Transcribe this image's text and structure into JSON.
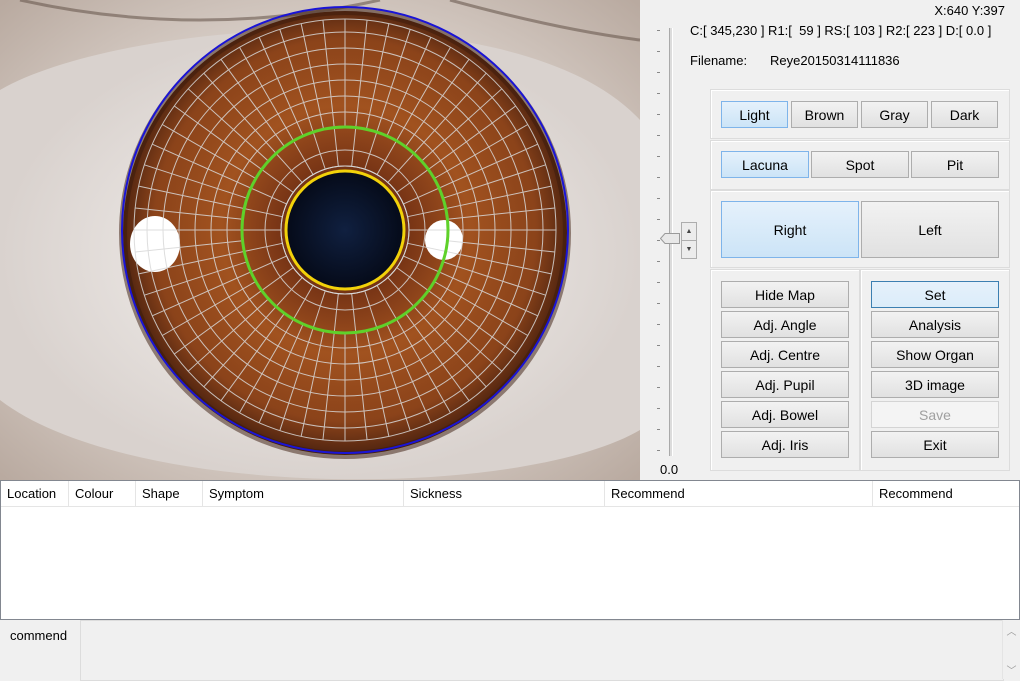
{
  "readout": {
    "coords": "X:640 Y:397",
    "params": "C:[ 345,230 ] R1:[  59 ] RS:[ 103 ] R2:[ 223 ] D:[ 0.0 ]",
    "filename_label": "Filename:",
    "filename_value": "Reye20150314111836"
  },
  "slider": {
    "value_label": "0.0",
    "position": 0.49
  },
  "colour_buttons": {
    "light": "Light",
    "brown": "Brown",
    "gray": "Gray",
    "dark": "Dark",
    "selected": "Light"
  },
  "mark_buttons": {
    "lacuna": "Lacuna",
    "spot": "Spot",
    "pit": "Pit",
    "selected": "Lacuna"
  },
  "side_buttons": {
    "right": "Right",
    "left": "Left",
    "selected": "Right"
  },
  "adjust_buttons": {
    "hide_map": "Hide Map",
    "adj_angle": "Adj. Angle",
    "adj_centre": "Adj. Centre",
    "adj_pupil": "Adj. Pupil",
    "adj_bowel": "Adj. Bowel",
    "adj_iris": "Adj. Iris"
  },
  "action_buttons": {
    "set": "Set",
    "analysis": "Analysis",
    "show_organ": "Show Organ",
    "image_3d": "3D image",
    "save": "Save",
    "exit": "Exit"
  },
  "table": {
    "columns": [
      "Location",
      "Colour",
      "Shape",
      "Symptom",
      "Sickness",
      "Recommend",
      "Recommend"
    ],
    "rows": []
  },
  "comment": {
    "label": "commend",
    "value": ""
  },
  "colors": {
    "outer_circle": "#1a14d6",
    "iris_boundary": "#5fd12a",
    "pupil_ring": "#f2d20a",
    "grid": "#d8d8d8",
    "accent_selected": "#cce4f7"
  },
  "icons": {
    "spin_up": "spin-up-icon",
    "spin_down": "spin-down-icon",
    "scroll_up": "scroll-up-icon",
    "scroll_down": "scroll-down-icon"
  }
}
